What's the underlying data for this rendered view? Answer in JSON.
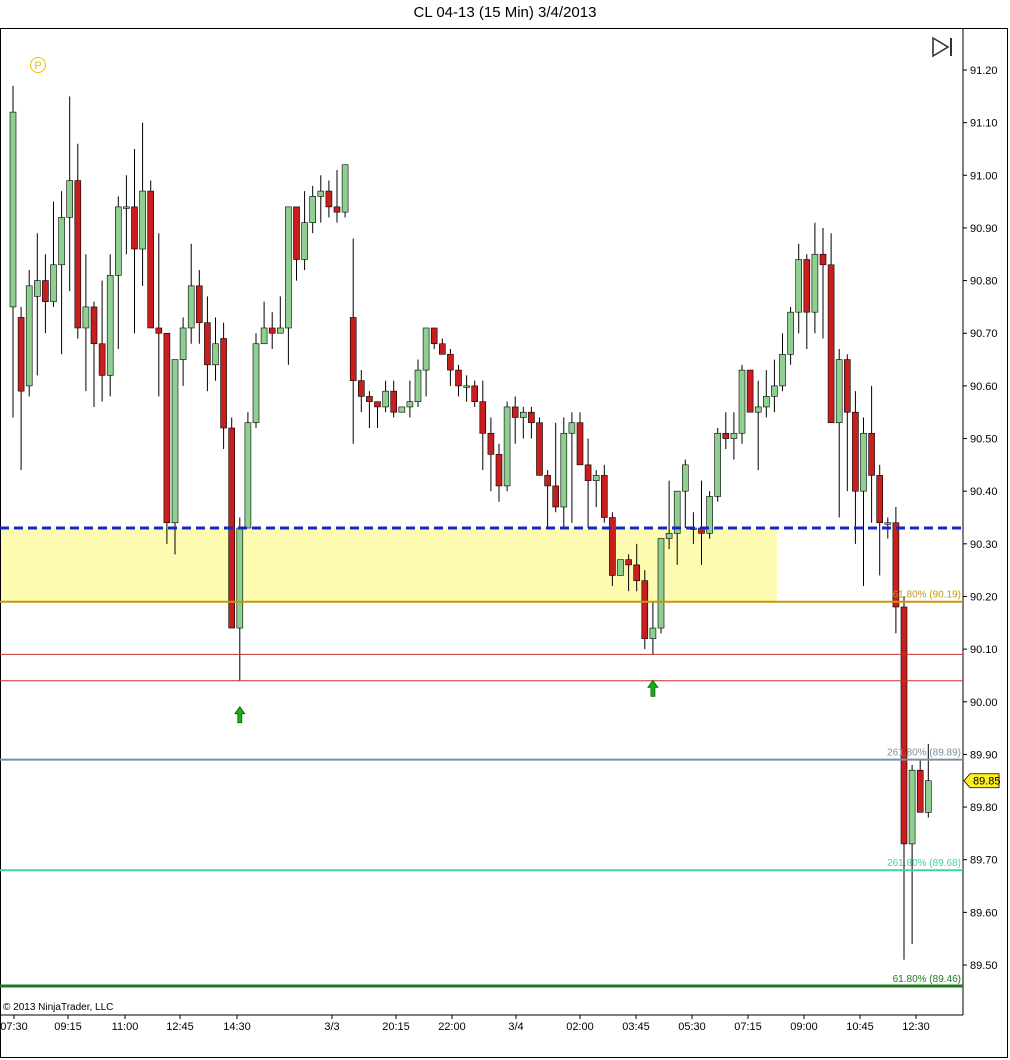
{
  "title": "CL 04-13 (15 Min)  3/4/2013",
  "copyright": "© 2013 NinjaTrader, LLC",
  "p_marker": "P",
  "chart_data": {
    "type": "candlestick",
    "ylim": [
      89.42,
      91.3
    ],
    "yticks": [
      "91.20",
      "91.10",
      "91.00",
      "90.90",
      "90.80",
      "90.70",
      "90.60",
      "90.50",
      "90.40",
      "90.30",
      "90.20",
      "90.10",
      "90.00",
      "89.90",
      "89.80",
      "89.70",
      "89.60",
      "89.50"
    ],
    "xticks": [
      "07:30",
      "09:15",
      "11:00",
      "12:45",
      "14:30",
      "3/3",
      "20:15",
      "22:00",
      "3/4",
      "02:00",
      "03:45",
      "05:30",
      "07:15",
      "09:00",
      "10:45",
      "12:30"
    ],
    "last_price": "89.85",
    "colors": {
      "up": "#8fcf8f",
      "down": "#c81e1e",
      "wick": "#000000"
    },
    "candles": [
      [
        90.75,
        91.17,
        90.54,
        91.12
      ],
      [
        90.73,
        90.75,
        90.44,
        90.59
      ],
      [
        90.6,
        90.82,
        90.58,
        90.79
      ],
      [
        90.77,
        90.89,
        90.62,
        90.8
      ],
      [
        90.8,
        90.85,
        90.7,
        90.76
      ],
      [
        90.76,
        90.95,
        90.75,
        90.83
      ],
      [
        90.83,
        90.97,
        90.66,
        90.92
      ],
      [
        90.92,
        91.15,
        90.78,
        90.99
      ],
      [
        90.99,
        91.06,
        90.69,
        90.71
      ],
      [
        90.71,
        90.85,
        90.59,
        90.75
      ],
      [
        90.75,
        90.76,
        90.56,
        90.68
      ],
      [
        90.68,
        90.8,
        90.57,
        90.62
      ],
      [
        90.62,
        90.85,
        90.58,
        90.81
      ],
      [
        90.81,
        90.96,
        90.67,
        90.94
      ],
      [
        90.94,
        91.0,
        90.85,
        90.94
      ],
      [
        90.94,
        91.05,
        90.7,
        90.86
      ],
      [
        90.86,
        91.1,
        90.79,
        90.97
      ],
      [
        90.97,
        90.99,
        90.81,
        90.71
      ],
      [
        90.71,
        90.89,
        90.58,
        90.7
      ],
      [
        90.7,
        90.7,
        90.3,
        90.34
      ],
      [
        90.34,
        90.62,
        90.28,
        90.65
      ],
      [
        90.65,
        90.73,
        90.6,
        90.71
      ],
      [
        90.71,
        90.87,
        90.68,
        90.79
      ],
      [
        90.79,
        90.82,
        90.68,
        90.72
      ],
      [
        90.72,
        90.77,
        90.59,
        90.64
      ],
      [
        90.64,
        90.73,
        90.61,
        90.68
      ],
      [
        90.69,
        90.72,
        90.48,
        90.52
      ],
      [
        90.52,
        90.54,
        90.3,
        90.14
      ],
      [
        90.14,
        90.35,
        90.04,
        90.33
      ],
      [
        90.33,
        90.55,
        90.33,
        90.53
      ],
      [
        90.53,
        90.7,
        90.52,
        90.68
      ],
      [
        90.68,
        90.76,
        90.68,
        90.71
      ],
      [
        90.71,
        90.74,
        90.67,
        90.7
      ],
      [
        90.7,
        90.77,
        90.7,
        90.71
      ],
      [
        90.71,
        90.94,
        90.64,
        90.94
      ],
      [
        90.94,
        90.85,
        90.8,
        90.84
      ],
      [
        90.84,
        90.97,
        90.82,
        90.91
      ],
      [
        90.91,
        90.98,
        90.89,
        90.96
      ],
      [
        90.96,
        91.0,
        90.91,
        90.97
      ],
      [
        90.97,
        90.99,
        90.92,
        90.94
      ],
      [
        90.94,
        91.01,
        90.91,
        90.93
      ],
      [
        90.93,
        91.02,
        90.92,
        91.02
      ],
      [
        90.73,
        90.88,
        90.49,
        90.61
      ],
      [
        90.61,
        90.63,
        90.55,
        90.58
      ],
      [
        90.58,
        90.59,
        90.52,
        90.57
      ],
      [
        90.57,
        90.57,
        90.52,
        90.56
      ],
      [
        90.56,
        90.61,
        90.55,
        90.59
      ],
      [
        90.59,
        90.61,
        90.54,
        90.55
      ],
      [
        90.55,
        90.56,
        90.55,
        90.56
      ],
      [
        90.56,
        90.61,
        90.54,
        90.57
      ],
      [
        90.57,
        90.65,
        90.56,
        90.63
      ],
      [
        90.63,
        90.7,
        90.58,
        90.71
      ],
      [
        90.71,
        90.7,
        90.67,
        90.68
      ],
      [
        90.68,
        90.69,
        90.66,
        90.66
      ],
      [
        90.66,
        90.67,
        90.6,
        90.63
      ],
      [
        90.63,
        90.64,
        90.58,
        90.6
      ],
      [
        90.6,
        90.62,
        90.57,
        90.6
      ],
      [
        90.6,
        90.61,
        90.56,
        90.57
      ],
      [
        90.57,
        90.61,
        90.44,
        90.51
      ],
      [
        90.51,
        90.54,
        90.4,
        90.47
      ],
      [
        90.47,
        90.49,
        90.38,
        90.41
      ],
      [
        90.41,
        90.57,
        90.4,
        90.56
      ],
      [
        90.56,
        90.58,
        90.49,
        90.54
      ],
      [
        90.54,
        90.56,
        90.5,
        90.55
      ],
      [
        90.55,
        90.56,
        90.5,
        90.53
      ],
      [
        90.53,
        90.54,
        90.45,
        90.43
      ],
      [
        90.43,
        90.44,
        90.33,
        90.41
      ],
      [
        90.41,
        90.53,
        90.36,
        90.37
      ],
      [
        90.37,
        90.54,
        90.33,
        90.51
      ],
      [
        90.51,
        90.55,
        90.34,
        90.53
      ],
      [
        90.53,
        90.55,
        90.45,
        90.45
      ],
      [
        90.45,
        90.5,
        90.33,
        90.42
      ],
      [
        90.42,
        90.44,
        90.37,
        90.43
      ],
      [
        90.43,
        90.45,
        90.34,
        90.35
      ],
      [
        90.35,
        90.36,
        90.22,
        90.24
      ],
      [
        90.24,
        90.26,
        90.24,
        90.27
      ],
      [
        90.27,
        90.28,
        90.21,
        90.26
      ],
      [
        90.26,
        90.3,
        90.21,
        90.23
      ],
      [
        90.23,
        90.25,
        90.1,
        90.12
      ],
      [
        90.12,
        90.19,
        90.09,
        90.14
      ],
      [
        90.14,
        90.31,
        90.13,
        90.31
      ],
      [
        90.31,
        90.42,
        90.29,
        90.32
      ],
      [
        90.32,
        90.4,
        90.26,
        90.4
      ],
      [
        90.4,
        90.46,
        90.33,
        90.45
      ],
      [
        90.33,
        90.36,
        90.3,
        90.33
      ],
      [
        90.33,
        90.42,
        90.26,
        90.32
      ],
      [
        90.32,
        90.4,
        90.31,
        90.39
      ],
      [
        90.39,
        90.52,
        90.38,
        90.51
      ],
      [
        90.51,
        90.55,
        90.48,
        90.5
      ],
      [
        90.5,
        90.55,
        90.46,
        90.51
      ],
      [
        90.51,
        90.64,
        90.49,
        90.63
      ],
      [
        90.63,
        90.63,
        90.55,
        90.55
      ],
      [
        90.55,
        90.61,
        90.44,
        90.56
      ],
      [
        90.56,
        90.63,
        90.54,
        90.58
      ],
      [
        90.58,
        90.65,
        90.55,
        90.6
      ],
      [
        90.6,
        90.7,
        90.59,
        90.66
      ],
      [
        90.66,
        90.75,
        90.64,
        90.74
      ],
      [
        90.74,
        90.87,
        90.7,
        90.84
      ],
      [
        90.84,
        90.85,
        90.67,
        90.74
      ],
      [
        90.74,
        90.91,
        90.7,
        90.85
      ],
      [
        90.85,
        90.9,
        90.69,
        90.83
      ],
      [
        90.83,
        90.89,
        90.53,
        90.53
      ],
      [
        90.53,
        90.67,
        90.35,
        90.65
      ],
      [
        90.65,
        90.66,
        90.4,
        90.55
      ],
      [
        90.55,
        90.59,
        90.3,
        90.4
      ],
      [
        90.4,
        90.54,
        90.22,
        90.51
      ],
      [
        90.51,
        90.6,
        90.34,
        90.43
      ],
      [
        90.43,
        90.45,
        90.24,
        90.34
      ],
      [
        90.34,
        90.35,
        90.31,
        90.34
      ],
      [
        90.34,
        90.37,
        90.13,
        90.18
      ],
      [
        90.18,
        90.2,
        89.51,
        89.73
      ],
      [
        89.73,
        89.88,
        89.54,
        89.87
      ],
      [
        89.87,
        89.89,
        89.79,
        89.79
      ],
      [
        89.79,
        89.92,
        89.78,
        89.85
      ]
    ],
    "levels": [
      {
        "name": "dashed-blue-line",
        "value": 90.33,
        "color": "#1428c8"
      },
      {
        "name": "fib-level-1",
        "value": 90.19,
        "color": "#c8960a",
        "label": "61.80% (90.19)"
      },
      {
        "name": "red-line-upper",
        "value": 90.09,
        "color": "#c83232"
      },
      {
        "name": "red-line-lower",
        "value": 90.04,
        "color": "#c83232"
      },
      {
        "name": "fib-level-2",
        "value": 89.89,
        "color": "#7890a0",
        "label": "261.80% (89.89)"
      },
      {
        "name": "fib-level-3",
        "value": 89.68,
        "color": "#40d2aa",
        "label": "261.80% (89.68)"
      },
      {
        "name": "fib-level-4",
        "value": 89.46,
        "color": "#1e781e",
        "label": "61.80% (89.46)"
      }
    ],
    "zone": {
      "top": 90.33,
      "bottom": 90.19,
      "color": "#fdfbb0"
    },
    "signals": [
      {
        "name": "buy-arrow-1",
        "index": 28
      },
      {
        "name": "buy-arrow-2",
        "index": 79
      }
    ]
  }
}
